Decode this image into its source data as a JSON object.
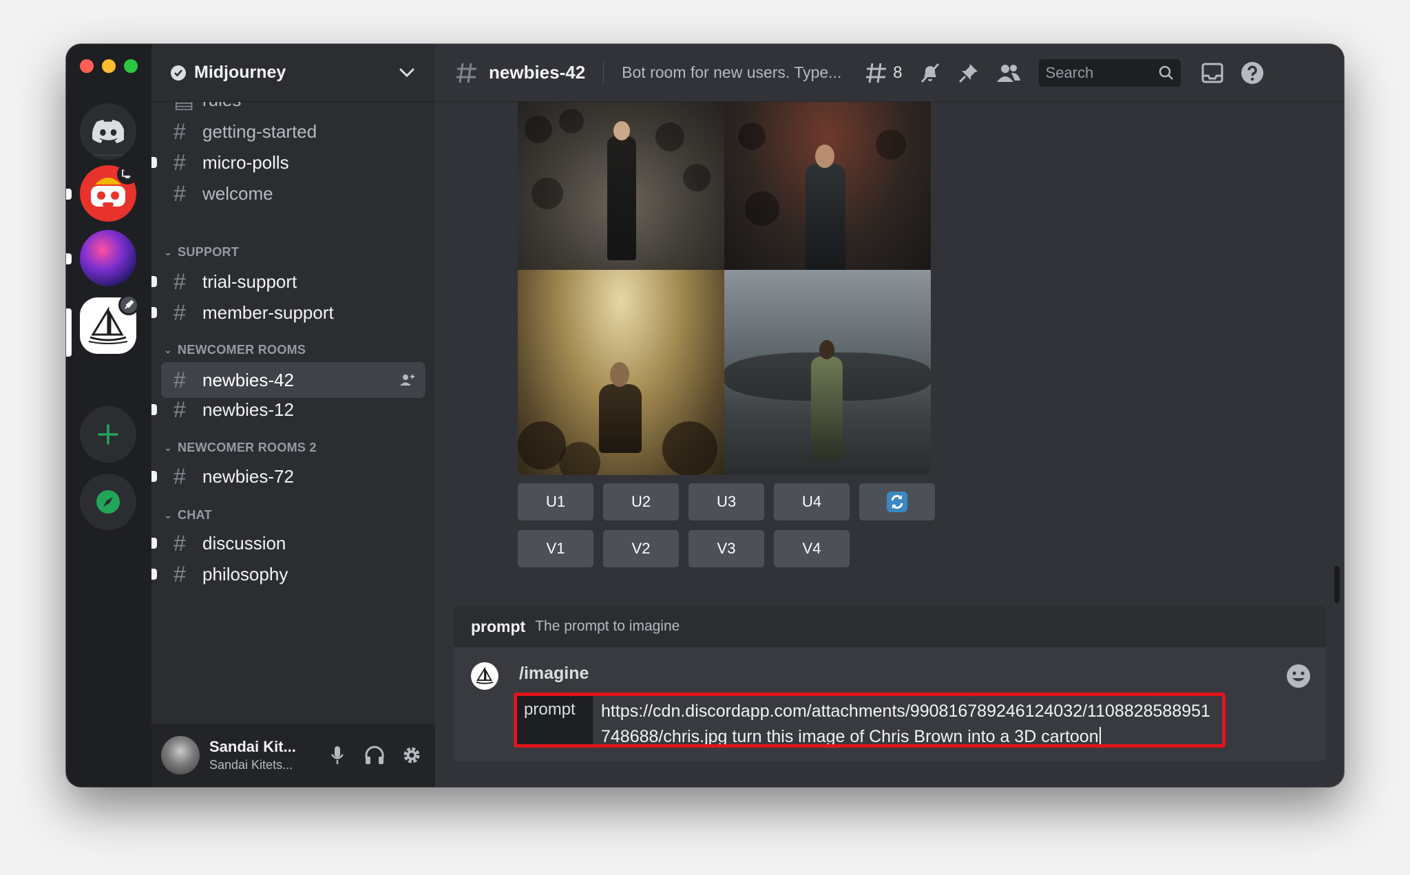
{
  "server": {
    "name": "Midjourney"
  },
  "channels_partial_top": "rules",
  "channels": [
    {
      "name": "getting-started",
      "type": "text",
      "unread": false,
      "bright": false
    },
    {
      "name": "micro-polls",
      "type": "text",
      "unread": true,
      "bright": true
    },
    {
      "name": "welcome",
      "type": "text",
      "unread": false,
      "bright": false
    }
  ],
  "categories": {
    "support": "SUPPORT",
    "newcomer": "NEWCOMER ROOMS",
    "newcomer2": "NEWCOMER ROOMS 2",
    "chat": "CHAT"
  },
  "support_channels": [
    "trial-support",
    "member-support"
  ],
  "newcomer_channels": [
    "newbies-42",
    "newbies-12"
  ],
  "newcomer2_channels": [
    "newbies-72"
  ],
  "chat_channels": [
    "discussion",
    "philosophy"
  ],
  "active_channel": {
    "name": "newbies-42",
    "topic": "Bot room for new users. Type...",
    "thread_count": "8"
  },
  "search": {
    "placeholder": "Search"
  },
  "upscale_buttons": [
    "U1",
    "U2",
    "U3",
    "U4"
  ],
  "variation_buttons": [
    "V1",
    "V2",
    "V3",
    "V4"
  ],
  "composer": {
    "option_name": "prompt",
    "option_desc": "The prompt to imagine",
    "command": "/imagine",
    "prompt_label": "prompt",
    "prompt_value": "https://cdn.discordapp.com/attachments/990816789246124032/1108828588951748688/chris.jpg turn this image of Chris Brown into a 3D cartoon"
  },
  "user": {
    "name": "Sandai Kit...",
    "status": "Sandai Kitets..."
  },
  "colors": {
    "accent_red": "#e3131d",
    "online_green": "#23a559",
    "blurple": "#5865f2"
  },
  "icons": {
    "home": "discord-logo-icon",
    "add_server": "plus-icon",
    "explore": "compass-icon",
    "threads": "threads-icon",
    "mute": "bell-slash-icon",
    "pins": "pin-icon",
    "members": "members-icon",
    "search": "search-icon",
    "inbox": "inbox-icon",
    "help": "help-icon",
    "mic": "microphone-icon",
    "headphones": "headphones-icon",
    "settings": "gear-icon",
    "reroll": "refresh-icon",
    "emoji": "emoji-icon"
  }
}
